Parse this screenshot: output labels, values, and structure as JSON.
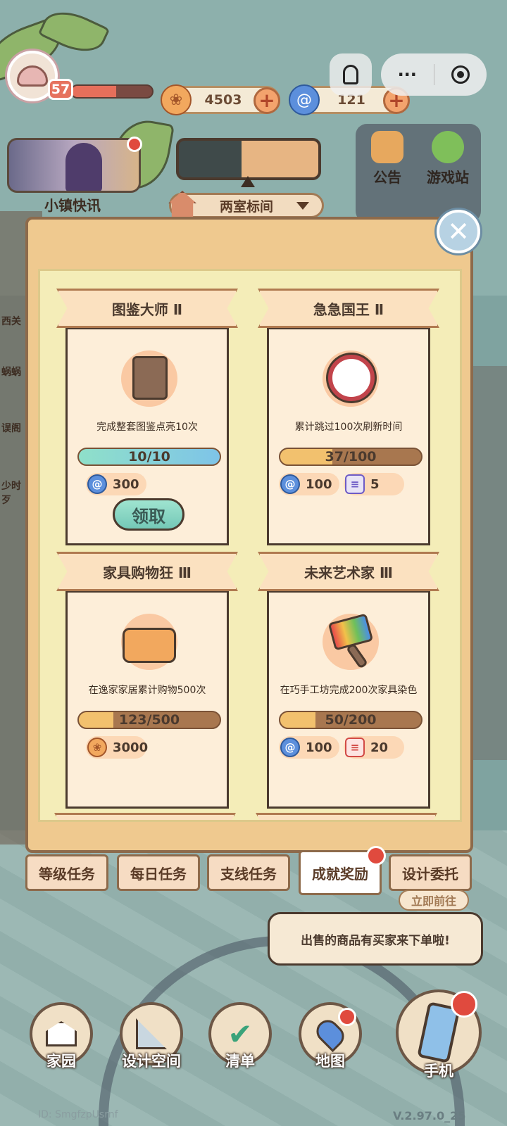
{
  "hud": {
    "level": "57",
    "xp_fraction": 0.55,
    "coins": "4503",
    "gems": "121"
  },
  "top": {
    "more_label": "···",
    "news_label": "小镇快讯",
    "room_name": "两室标间",
    "announcement_label": "公告",
    "game_station_label": "游戏站"
  },
  "left_side": [
    "西关",
    "蜗蜗",
    "误阁",
    "少时",
    "歹"
  ],
  "achievements": [
    {
      "title": "图鉴大师 Ⅱ",
      "icon": "book-icon",
      "description": "完成整套图鉴点亮10次",
      "progress_text": "10/10",
      "progress_fraction": 1.0,
      "rewards": [
        {
          "icon": "spiral-gem-icon",
          "amount": "300"
        }
      ],
      "claim_label": "领取"
    },
    {
      "title": "急急国王 Ⅱ",
      "icon": "clock-icon",
      "description": "累计跳过100次刷新时间",
      "progress_text": "37/100",
      "progress_fraction": 0.37,
      "rewards": [
        {
          "icon": "spiral-gem-icon",
          "amount": "100"
        },
        {
          "icon": "ticket-icon",
          "amount": "5"
        }
      ]
    },
    {
      "title": "家具购物狂 Ⅲ",
      "icon": "sofa-icon",
      "description": "在逸家家居累计购物500次",
      "progress_text": "123/500",
      "progress_fraction": 0.246,
      "rewards": [
        {
          "icon": "coin-icon",
          "amount": "3000"
        }
      ]
    },
    {
      "title": "未来艺术家 Ⅲ",
      "icon": "paint-brush-icon",
      "description": "在巧手工坊完成200次家具染色",
      "progress_text": "50/200",
      "progress_fraction": 0.25,
      "rewards": [
        {
          "icon": "spiral-gem-icon",
          "amount": "100"
        },
        {
          "icon": "red-ticket-icon",
          "amount": "20"
        }
      ]
    }
  ],
  "tabs": [
    "等级任务",
    "每日任务",
    "支线任务",
    "成就奖励",
    "设计委托"
  ],
  "active_tab": "成就奖励",
  "go_now_label": "立即前往",
  "speech_text": "出售的商品有买家来下单啦!",
  "nav": [
    "家园",
    "设计空间",
    "清单",
    "地图",
    "手机"
  ],
  "footer": {
    "id_text": "ID: SmgfzpUsrnf",
    "version": "V.2.97.0_25"
  },
  "colors": {
    "modal_bg": "#efc98f",
    "card_bg": "#fdeed9",
    "progress_fill": "#f2c16e",
    "progress_done": "#8fe0c9",
    "badge_red": "#e04a3e"
  }
}
